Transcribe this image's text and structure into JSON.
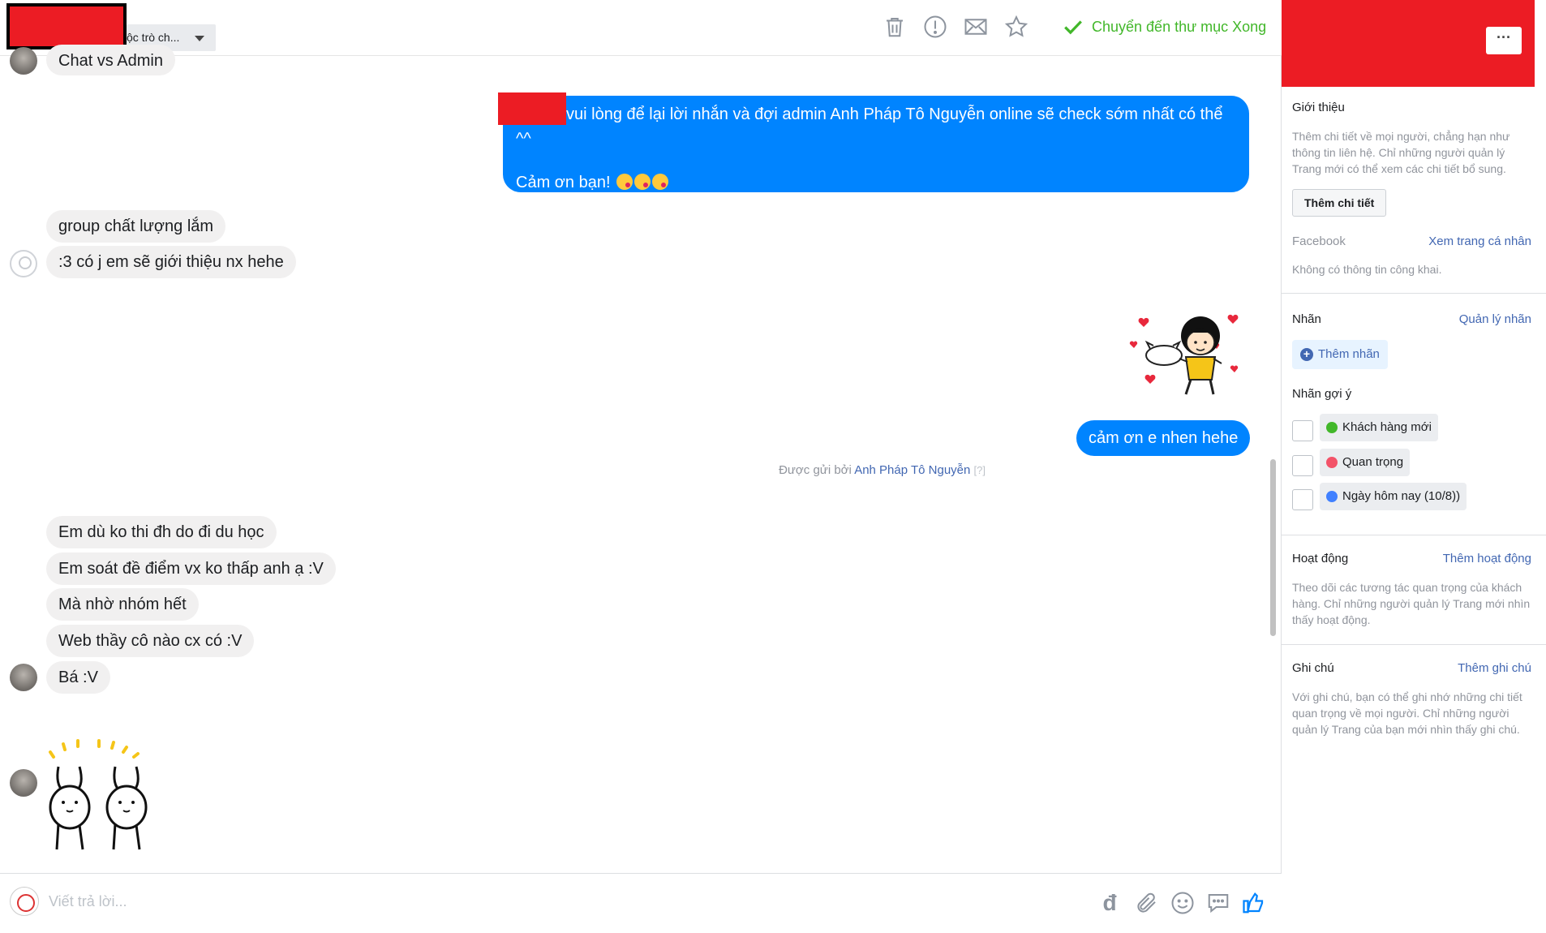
{
  "header": {
    "label_dropdown": "ộc trò ch...",
    "done_button": "Chuyển đến thư mục Xong"
  },
  "conversation": {
    "prev_message": "Chat vs Admin",
    "auto_reply": {
      "line1": "vui lòng để lại lời nhắn và đợi admin Anh Pháp Tô Nguyễn online sẽ check sớm nhất có thể",
      "line2": "^^",
      "line3": "Cảm ơn bạn!"
    },
    "incoming_1": [
      "group chất lượng lắm",
      ":3 có j em sẽ giới thiệu nx hehe"
    ],
    "outgoing_thanks": "cảm ơn e nhen hehe",
    "sent_by_prefix": "Được gửi bởi",
    "sent_by_name": "Anh Pháp Tô Nguyễn",
    "sent_by_help": "[?]",
    "incoming_2": [
      "Em dù ko thi đh do đi du học",
      "Em soát đề điểm vx ko thấp anh ạ :V",
      "Mà nhờ nhóm hết",
      "Web thầy cô nào cx có :V",
      "Bá :V"
    ]
  },
  "composer": {
    "placeholder": "Viết trả lời...",
    "currency_glyph": "đ"
  },
  "panel": {
    "more_button": "···",
    "intro": {
      "title": "Giới thiệu",
      "text": "Thêm chi tiết về mọi người, chẳng hạn như thông tin liên hệ. Chỉ những người quản lý Trang mới có thể xem các chi tiết bổ sung.",
      "button": "Thêm chi tiết",
      "facebook_label": "Facebook",
      "facebook_link": "Xem trang cá nhân",
      "facebook_text": "Không có thông tin công khai."
    },
    "tags": {
      "title": "Nhãn",
      "manage_link": "Quản lý nhãn",
      "add_button": "Thêm nhãn",
      "suggested_title": "Nhãn gợi ý",
      "suggested": [
        {
          "label": "Khách hàng mới",
          "color": "#42b72a"
        },
        {
          "label": "Quan trọng",
          "color": "#f35369"
        },
        {
          "label": "Ngày hôm nay (10/8))",
          "color": "#4080ff"
        }
      ]
    },
    "activity": {
      "title": "Hoạt động",
      "link": "Thêm hoạt động",
      "text": "Theo dõi các tương tác quan trọng của khách hàng. Chỉ những người quản lý Trang mới nhìn thấy hoạt động."
    },
    "notes": {
      "title": "Ghi chú",
      "link": "Thêm ghi chú",
      "text": "Với ghi chú, bạn có thể ghi nhớ những chi tiết quan trọng về mọi người. Chỉ những người quản lý Trang của bạn mới nhìn thấy ghi chú."
    }
  },
  "colors": {
    "messenger_blue": "#0084ff",
    "link_blue": "#4267b2",
    "done_green": "#42b72a",
    "redaction_red": "#ec1c24"
  }
}
